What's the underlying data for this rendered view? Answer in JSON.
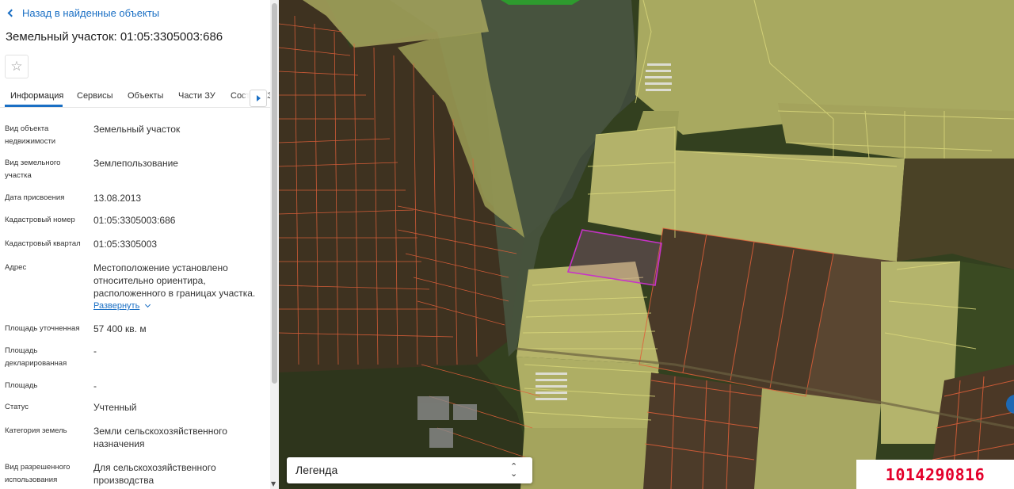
{
  "back_link": "Назад в найденные объекты",
  "title": "Земельный участок: 01:05:3305003:686",
  "favorite_icon": "star-icon",
  "tabs": [
    "Информация",
    "Сервисы",
    "Объекты",
    "Части ЗУ",
    "Состав ЕЗП"
  ],
  "active_tab": "Информация",
  "fields": {
    "object_type": {
      "label": "Вид объекта недвижимости",
      "value": "Земельный участок"
    },
    "land_type": {
      "label": "Вид земельного участка",
      "value": "Землепользование"
    },
    "assign_date": {
      "label": "Дата присвоения",
      "value": "13.08.2013"
    },
    "cadastral_number": {
      "label": "Кадастровый номер",
      "value": "01:05:3305003:686"
    },
    "cadastral_quarter": {
      "label": "Кадастровый квартал",
      "value": "01:05:3305003"
    },
    "address": {
      "label": "Адрес",
      "value": "Местоположение установлено относительно ориентира, расположенного в границах участка."
    },
    "expand_label": "Развернуть",
    "area_specified": {
      "label": "Площадь уточненная",
      "value": "57 400 кв. м"
    },
    "area_declared": {
      "label": "Площадь декларированная",
      "value": "-"
    },
    "area": {
      "label": "Площадь",
      "value": "-"
    },
    "status": {
      "label": "Статус",
      "value": "Учтенный"
    },
    "land_category": {
      "label": "Категория земель",
      "value": "Земли сельскохозяйственного назначения"
    },
    "permitted_use": {
      "label": "Вид разрешенного использования",
      "value": "Для сельскохозяйственного производства"
    }
  },
  "map": {
    "legend_label": "Легенда",
    "listing_id": "1014290816"
  },
  "colors": {
    "accent": "#1a6fc4",
    "parcel_border": "#e0603a",
    "selected_parcel": "#c832c8",
    "field_fill": "#c9c878",
    "listing_id": "#e4002b"
  }
}
